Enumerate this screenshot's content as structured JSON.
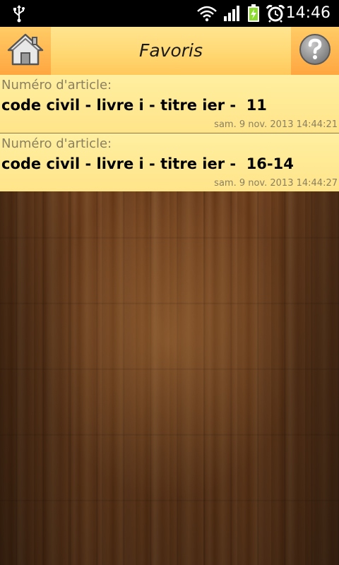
{
  "status_bar": {
    "time": "14:46",
    "icons": [
      "usb-icon",
      "wifi-icon",
      "signal-icon",
      "battery-charging-icon",
      "alarm-clock-icon"
    ]
  },
  "title_bar": {
    "title": "Favoris",
    "home_icon": "home-icon",
    "help_icon": "help-icon"
  },
  "favorites": [
    {
      "label": "Numéro d'article:",
      "title": "code civil - livre i - titre ier -  11",
      "date": "sam. 9 nov. 2013 14:44:21"
    },
    {
      "label": "Numéro d'article:",
      "title": "code civil - livre i - titre ier -  16-14",
      "date": "sam. 9 nov. 2013 14:44:27"
    }
  ],
  "colors": {
    "title_bar": "#ffd873",
    "list_item": "#ffe48a",
    "wood": "#6b3c1b",
    "battery": "#8bdc2f"
  }
}
